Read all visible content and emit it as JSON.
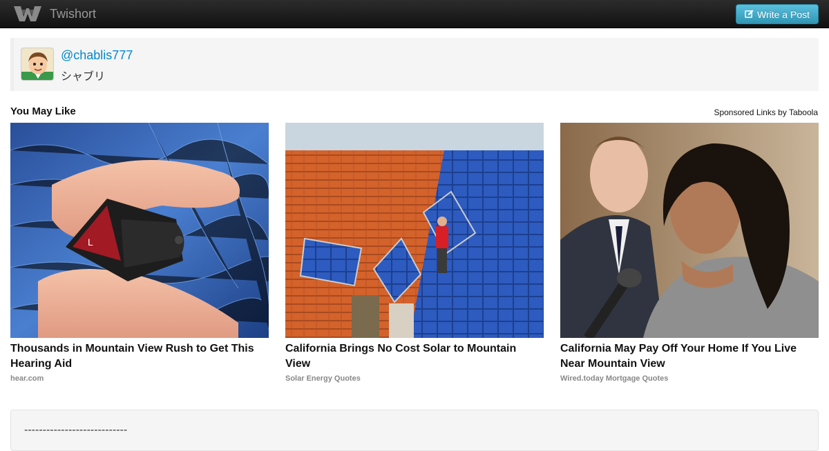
{
  "navbar": {
    "brand": "Twishort",
    "write_button": "Write a Post",
    "logo_icon": "twishort-logo-icon",
    "edit_icon": "edit-icon"
  },
  "profile": {
    "username": "@chablis777",
    "display_name": "シャブリ"
  },
  "recommendations": {
    "title": "You May Like",
    "sponsored_label": "Sponsored Links by Taboola",
    "items": [
      {
        "title": "Thousands in Mountain View Rush to Get This Hearing Aid",
        "source": "hear.com"
      },
      {
        "title": "California Brings No Cost Solar to Mountain View",
        "source": "Solar Energy Quotes"
      },
      {
        "title": "California May Pay Off Your Home If You Live Near Mountain View",
        "source": "Wired.today Mortgage Quotes"
      }
    ]
  },
  "bottom": {
    "dashes": "----------------------------"
  },
  "colors": {
    "link": "#0088cc",
    "button": "#49afcd",
    "navbar": "#1b1b1b"
  }
}
